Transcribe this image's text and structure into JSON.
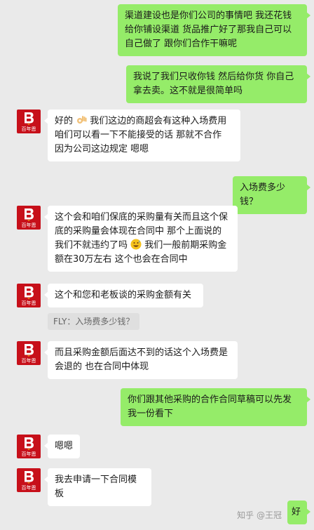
{
  "contact": {
    "brand_text": "百年恩"
  },
  "messages": [
    {
      "side": "me",
      "text": "渠道建设也是你们公司的事情吧 我还花钱给你铺设渠道 货品推广好了那我自己可以自己做了 跟你们合作干嘛呢"
    },
    {
      "side": "me",
      "text": "我说了我们只收你钱 然后给你货 你自己拿去卖。这不就是很简单吗"
    },
    {
      "side": "them",
      "text_before": "好的",
      "emoji": "ok-hand-emoji",
      "text_after": " 我们这边的商超会有这种入场费用 咱们可以看一下不能接受的话 那就不合作 因为公司这边规定 嗯嗯"
    },
    {
      "side": "me",
      "text": "入场费多少钱？"
    },
    {
      "side": "them",
      "text_before": "这个会和咱们保底的采购量有关而且这个保底的采购量会体现在合同中 那个上面说的我们不就违约了吗",
      "emoji": "grin-sweat-emoji",
      "text_after": "我们一般前期采购金额在30万左右 这个也会在合同中"
    },
    {
      "side": "them",
      "text": "这个和您和老板谈的采购金额有关"
    },
    {
      "side": "quote",
      "text": "FLY：入场费多少钱？"
    },
    {
      "side": "them",
      "text": "而且采购金额后面达不到的话这个入场费是会退的 也在合同中体现"
    },
    {
      "side": "me",
      "text": "你们跟其他采购的合作合同草稿可以先发我一份看下"
    },
    {
      "side": "them",
      "text": "嗯嗯"
    },
    {
      "side": "them",
      "text": "我去申请一下合同模板"
    },
    {
      "side": "me",
      "text": "好"
    }
  ],
  "watermark": "知乎 @王冠",
  "colors": {
    "my_bubble": "#95ec69",
    "their_bubble": "#ffffff",
    "background": "#eaeaea",
    "avatar": "#c7101a"
  }
}
